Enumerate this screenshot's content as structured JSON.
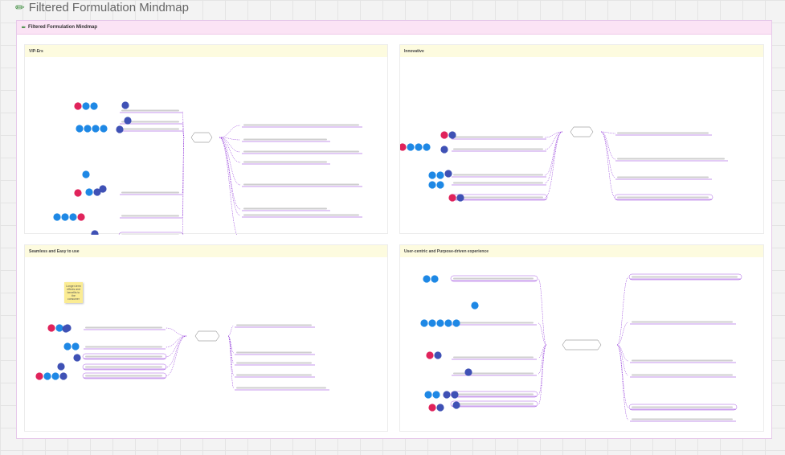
{
  "page": {
    "title": "Filtered Formulation Mindmap",
    "title_icon": "pencil-icon"
  },
  "board": {
    "header_title": "Filtered Formulation Mindmap",
    "header_icon": "pencil-icon",
    "header_color": "#fbe3f5",
    "frame_header_color": "#fdfbdf"
  },
  "frames": [
    {
      "title": "VIP-Ers",
      "hub": "VIP-ers"
    },
    {
      "title": "Innovative",
      "hub": "Innovative"
    },
    {
      "title": "Seamless and Easy to use",
      "hub": "Seamless and easy to use",
      "sticky": "Longer-term effects and benefits to the consumer"
    },
    {
      "title": "User-centric and Purpose-driven experience",
      "hub": "User-centric and purpose-driven experience"
    }
  ],
  "colors": {
    "avatar_blue": "#1e88e5",
    "avatar_red": "#e0235b",
    "avatar_navy": "#3f51b5",
    "connector": "#8b2bd8"
  }
}
